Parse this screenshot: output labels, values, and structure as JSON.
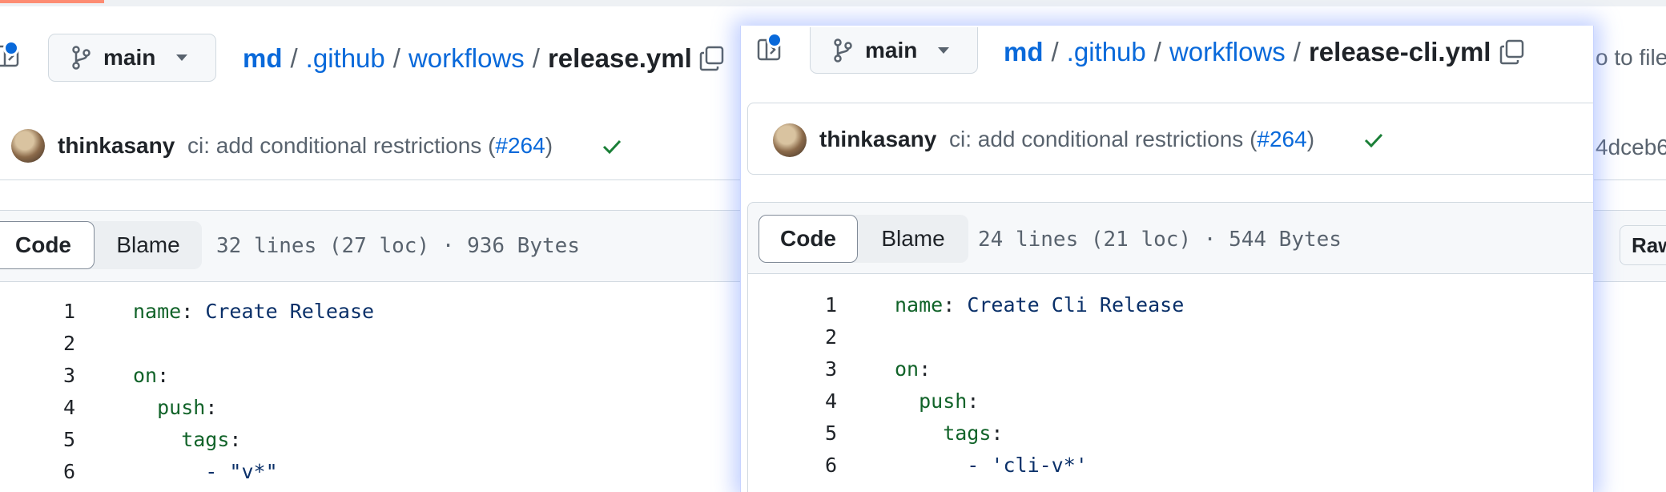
{
  "branch": {
    "label": "main"
  },
  "colors": {
    "link": "#0969da",
    "check": "#1a7f37",
    "accent": "#fd8c73",
    "yaml_key": "#116329",
    "yaml_string": "#0a3069"
  },
  "background": {
    "breadcrumb": {
      "repo": "md",
      "dir1": ".github",
      "dir2": "workflows",
      "file": "release.yml",
      "sep": "/"
    },
    "commit": {
      "author": "thinkasany",
      "message": "ci: add conditional restrictions (",
      "pr": "#264",
      "close": ")"
    },
    "tabs": {
      "code": "Code",
      "blame": "Blame"
    },
    "file_info": "32 lines (27 loc) · 936 Bytes",
    "lines": [
      {
        "num": "1",
        "key": "name",
        "colon": ":",
        "value": " Create Release"
      },
      {
        "num": "2",
        "key": "",
        "colon": "",
        "value": ""
      },
      {
        "num": "3",
        "key": "on",
        "colon": ":",
        "value": ""
      },
      {
        "num": "4",
        "key": "  push",
        "colon": ":",
        "value": ""
      },
      {
        "num": "5",
        "key": "    tags",
        "colon": ":",
        "value": ""
      },
      {
        "num": "6",
        "key": "",
        "colon": "",
        "value": "      - \"v*\""
      }
    ],
    "goto_file": "o to file",
    "sha": "4dceb6",
    "raw": "Raw"
  },
  "popup": {
    "breadcrumb": {
      "repo": "md",
      "dir1": ".github",
      "dir2": "workflows",
      "file": "release-cli.yml",
      "sep": "/"
    },
    "commit": {
      "author": "thinkasany",
      "message": "ci: add conditional restrictions (",
      "pr": "#264",
      "close": ")"
    },
    "tabs": {
      "code": "Code",
      "blame": "Blame"
    },
    "file_info": "24 lines (21 loc) · 544 Bytes",
    "lines": [
      {
        "num": "1",
        "key": "name",
        "colon": ":",
        "value": " Create Cli Release"
      },
      {
        "num": "2",
        "key": "",
        "colon": "",
        "value": ""
      },
      {
        "num": "3",
        "key": "on",
        "colon": ":",
        "value": ""
      },
      {
        "num": "4",
        "key": "  push",
        "colon": ":",
        "value": ""
      },
      {
        "num": "5",
        "key": "    tags",
        "colon": ":",
        "value": ""
      },
      {
        "num": "6",
        "key": "",
        "colon": "",
        "value": "      - 'cli-v*'"
      }
    ]
  }
}
